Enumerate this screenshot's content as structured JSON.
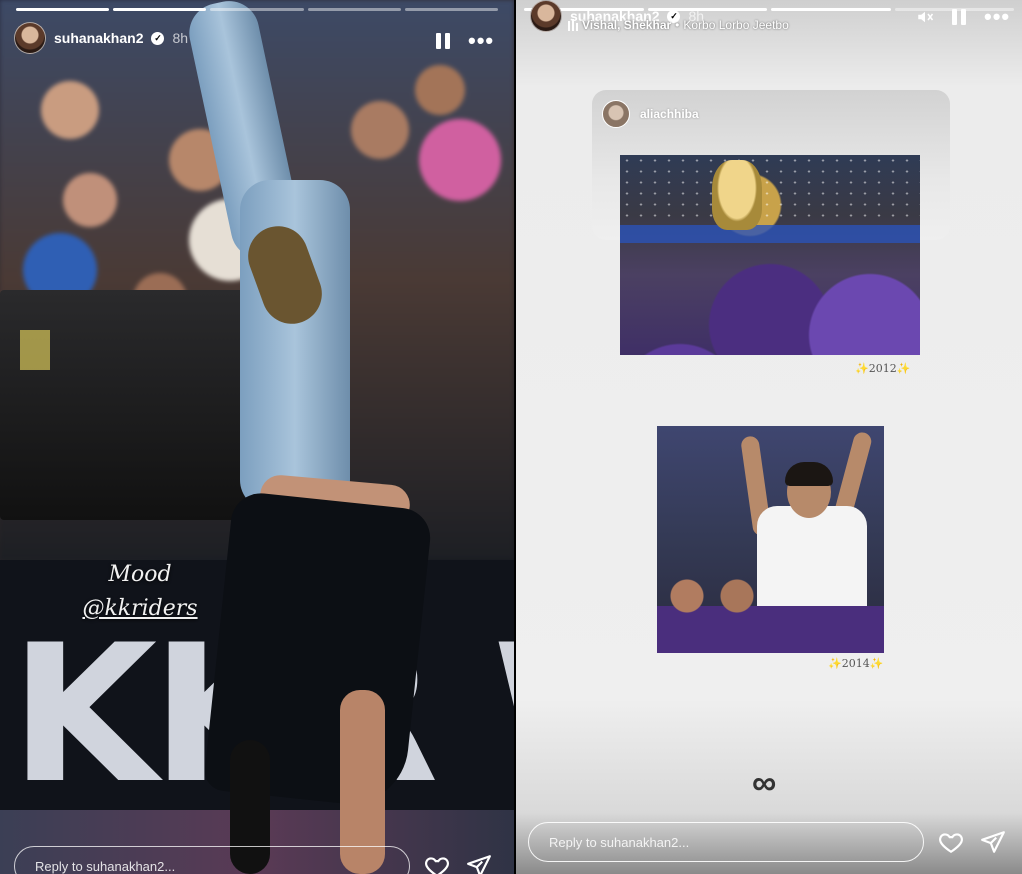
{
  "left_story": {
    "username": "suhanakhan2",
    "time": "8h",
    "caption_line1": "Mood",
    "caption_line2": "@kkriders",
    "board_text": "KKR WON",
    "reply_placeholder": "Reply to suhanakhan2..."
  },
  "right_story": {
    "username": "suhanakhan2",
    "time": "8h",
    "music_artist": "Vishal, Shekhar",
    "music_separator": "•",
    "music_title": "Korbo Lorbo Jeetbo",
    "repost_username": "aliachhiba",
    "caption_2012": "✨2012✨",
    "caption_2014": "✨2014✨",
    "infinity_symbol": "∞",
    "reply_placeholder": "Reply to suhanakhan2..."
  },
  "icons": {
    "verified": "✓",
    "more": "•••",
    "mute": "mute-icon",
    "pause": "pause-icon",
    "heart": "heart-icon",
    "send": "send-icon"
  },
  "colors": {
    "verified_badge": "#ffffff",
    "sparkle": "#e3b400"
  }
}
